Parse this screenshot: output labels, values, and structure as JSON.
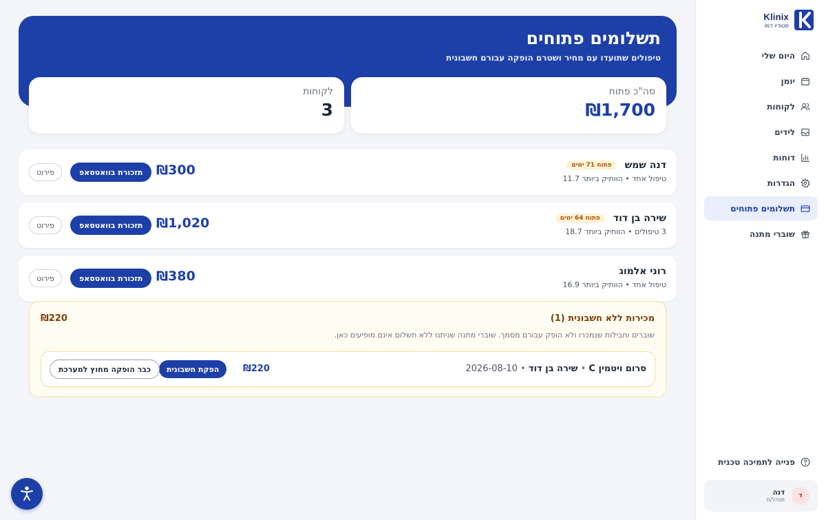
{
  "brand": {
    "name": "Klinix",
    "subtitle": "סטודיו דמו"
  },
  "sidebar": {
    "items": [
      {
        "label": "היום שלי",
        "icon": "home-icon"
      },
      {
        "label": "יומן",
        "icon": "calendar-icon"
      },
      {
        "label": "לקוחות",
        "icon": "users-icon"
      },
      {
        "label": "לידים",
        "icon": "inbox-icon"
      },
      {
        "label": "דוחות",
        "icon": "bar-chart-icon"
      },
      {
        "label": "הגדרות",
        "icon": "gear-icon"
      },
      {
        "label": "תשלומים פתוחים",
        "icon": "credit-card-icon",
        "active": true
      },
      {
        "label": "שוברי מתנה",
        "icon": "gift-icon"
      }
    ],
    "support_label": "פנייה לתמיכה טכנית",
    "user": {
      "initial": "ד",
      "name": "דנה",
      "role": "מנהל/ת"
    }
  },
  "header": {
    "title": "תשלומים פתוחים",
    "subtitle": "טיפולים שתועדו עם מחיר ושטרם הופקה עבורם חשבונית"
  },
  "stats": {
    "total": {
      "label": "סה\"כ פתוח",
      "value": "₪1,700"
    },
    "clients": {
      "label": "לקוחות",
      "value": "3"
    }
  },
  "rows": [
    {
      "name": "דנה שמש",
      "badge": "פתוח 71 ימים",
      "meta": "טיפול אחד • הוותיק ביותר 11.7",
      "amount": "₪300",
      "whatsapp_label": "תזכורת בוואטסאפ",
      "details_label": "פירוט"
    },
    {
      "name": "שירה בן דוד",
      "badge": "פתוח 64 ימים",
      "meta": "3 טיפולים • הוותיק ביותר 18.7",
      "amount": "₪1,020",
      "whatsapp_label": "תזכורת בוואטסאפ",
      "details_label": "פירוט"
    },
    {
      "name": "רוני אלמוג",
      "badge": "",
      "meta": "טיפול אחד • הוותיק ביותר 16.9",
      "amount": "₪380",
      "whatsapp_label": "תזכורת בוואטסאפ",
      "details_label": "פירוט"
    }
  ],
  "uninvoiced": {
    "title": "מכירות ללא חשבונית (1)",
    "total": "₪220",
    "description": "שוברים וחבילות שנמכרו ולא הופק עבורם מסמך. שוברי מתנה שניתנו ללא תשלום אינם מופיעים כאן.",
    "item": {
      "product": "סרום ויטמין C",
      "client": "שירה בן דוד",
      "date": "2026-08-10",
      "amount": "₪220",
      "invoice_label": "הפקת חשבונית",
      "external_label": "כבר הופקה מחוץ למערכת"
    }
  },
  "colors": {
    "primary": "#1d3fa8",
    "warning_bg": "#fffdf2",
    "warning_text": "#7c3e0c",
    "badge_bg": "#fdf3d7"
  }
}
